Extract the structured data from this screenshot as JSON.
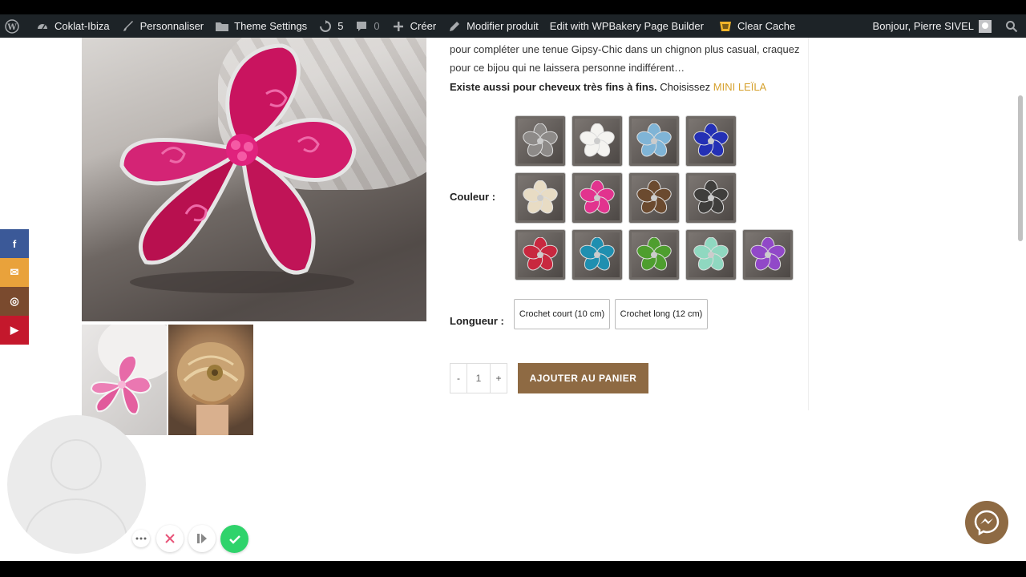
{
  "adminbar": {
    "site_name": "Coklat-Ibiza",
    "customize": "Personnaliser",
    "theme_settings": "Theme Settings",
    "updates_count": "5",
    "comments_count": "0",
    "create": "Créer",
    "edit_product": "Modifier produit",
    "wpbakery": "Edit with WPBakery Page Builder",
    "clear_cache": "Clear Cache",
    "greeting": "Bonjour, Pierre SIVEL"
  },
  "product": {
    "description": "pour compléter une tenue Gipsy-Chic dans un chignon plus casual, craquez pour ce bijou qui ne laissera personne indifférent…",
    "exists_bold": "Existe aussi pour cheveux très fins à fins.",
    "exists_text": "Choisissez",
    "exists_link": "MINI LEÏLA",
    "color_label": "Couleur :",
    "length_label": "Longueur :",
    "lengths": [
      "Crochet court (10 cm)",
      "Crochet long (12 cm)"
    ],
    "quantity": "1",
    "minus": "-",
    "plus": "+",
    "add_to_cart": "AJOUTER AU PANIER",
    "colors": [
      "#8d8a88",
      "#f4f3f0",
      "#7fb4d6",
      "#2430b5",
      "#e8dcc4",
      "#e2338e",
      "#6b4a2f",
      "#3f3e3c",
      "#c8283f",
      "#1f8fb0",
      "#4e9e2e",
      "#8fd8c0",
      "#9148c8"
    ],
    "main_flower_color": "#d21c6b"
  },
  "social": {
    "facebook": "f",
    "email": "✉",
    "instagram": "◎",
    "youtube": "▶"
  },
  "colors": {
    "accent": "#8e6a43",
    "link": "#d6a12e",
    "facebook": "#3b5998",
    "email": "#e9a23b",
    "instagram": "#7a4a2e",
    "youtube": "#c4182c"
  }
}
